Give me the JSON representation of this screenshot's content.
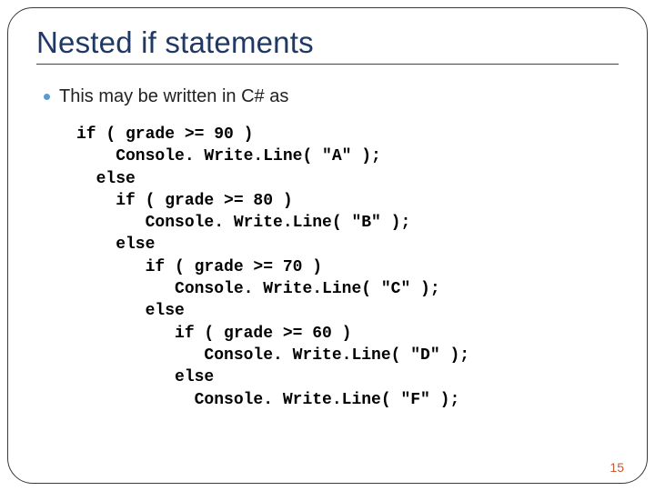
{
  "title": "Nested if statements",
  "bullet_text": "This may be written in C# as",
  "code": "if ( grade >= 90 )\n    Console. Write.Line( \"A\" ); \n  else \n    if ( grade >= 80 ) \n       Console. Write.Line( \"B\" ); \n    else \n       if ( grade >= 70 ) \n          Console. Write.Line( \"C\" ); \n       else \n          if ( grade >= 60 ) \n             Console. Write.Line( \"D\" ); \n          else \n            Console. Write.Line( \"F\" );",
  "page_number": "15"
}
